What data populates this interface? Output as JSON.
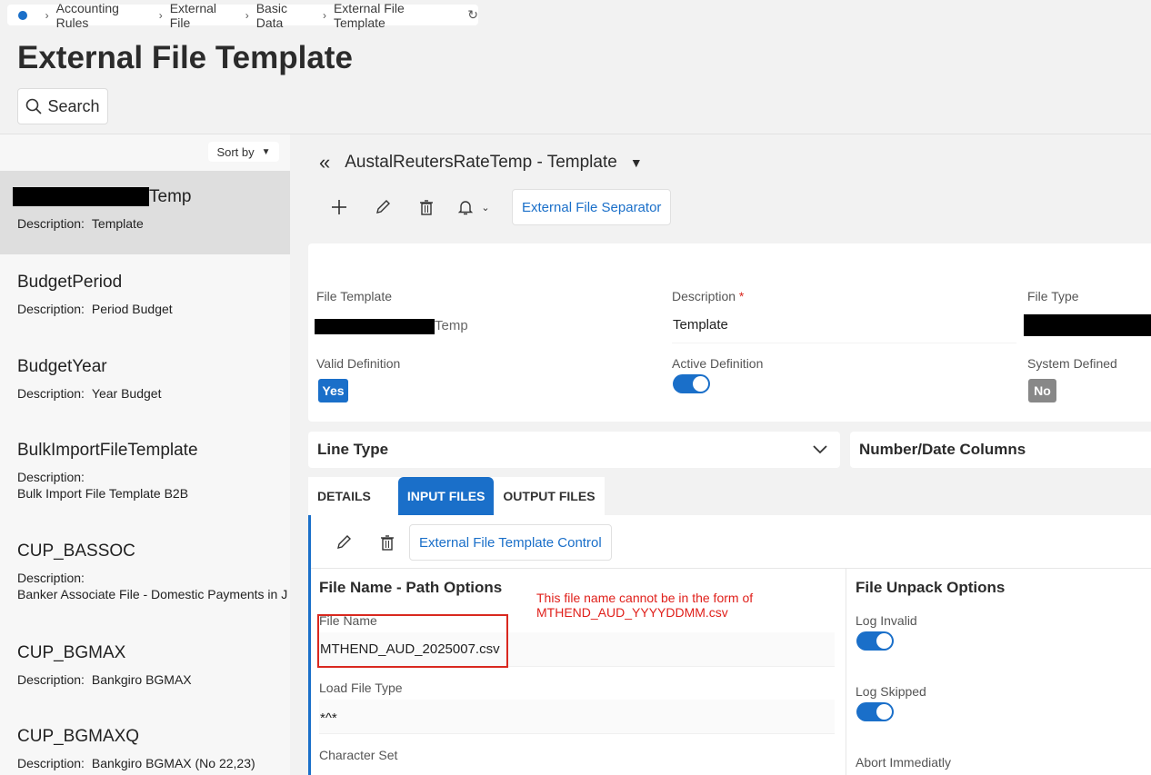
{
  "breadcrumb": {
    "items": [
      "Accounting Rules",
      "External File",
      "Basic Data",
      "External File Template"
    ]
  },
  "page_title": "External File Template",
  "search": {
    "label": "Search"
  },
  "sort": {
    "label": "Sort by"
  },
  "list": {
    "items": [
      {
        "title_suffix": "Temp",
        "desc_label": "Description:",
        "desc_value": "Template"
      },
      {
        "title": "BudgetPeriod",
        "desc_label": "Description:",
        "desc_value": "Period Budget"
      },
      {
        "title": "BudgetYear",
        "desc_label": "Description:",
        "desc_value": "Year Budget"
      },
      {
        "title": "BulkImportFileTemplate",
        "desc_label": "Description:",
        "desc_value": "Bulk Import File Template B2B"
      },
      {
        "title": "CUP_BASSOC",
        "desc_label": "Description:",
        "desc_value": "Banker Associate File - Domestic Payments in J"
      },
      {
        "title": "CUP_BGMAX",
        "desc_label": "Description:",
        "desc_value": "Bankgiro BGMAX"
      },
      {
        "title": "CUP_BGMAXQ",
        "desc_label": "Description:",
        "desc_value": "Bankgiro BGMAX (No 22,23)"
      }
    ]
  },
  "record": {
    "header": "AustalReutersRateTemp - Template",
    "toolbar": {
      "separator_button": "External File Separator"
    },
    "fields": {
      "file_template_label": "File Template",
      "file_template_suffix": "Temp",
      "description_label": "Description",
      "description_required": "*",
      "description_value": "Template",
      "file_type_label": "File Type",
      "valid_definition_label": "Valid Definition",
      "valid_definition_value": "Yes",
      "active_definition_label": "Active Definition",
      "system_defined_label": "System Defined",
      "system_defined_value": "No"
    },
    "sections": {
      "line_type": "Line Type",
      "number_date_columns": "Number/Date Columns"
    },
    "tabs": [
      "DETAILS",
      "INPUT FILES",
      "OUTPUT FILES"
    ],
    "input_files": {
      "control_button": "External File Template Control",
      "path_options_title": "File Name - Path Options",
      "unpack_options_title": "File Unpack Options",
      "note_line1": "This file name cannot be in the form of",
      "note_line2": "MTHEND_AUD_YYYYDDMM.csv",
      "file_name_label": "File Name",
      "file_name_value": "MTHEND_AUD_2025007.csv",
      "load_file_type_label": "Load File Type",
      "load_file_type_value": "*^*",
      "character_set_label": "Character Set",
      "log_invalid_label": "Log Invalid",
      "log_skipped_label": "Log Skipped",
      "abort_immediately_label": "Abort Immediatly"
    }
  },
  "colors": {
    "accent": "#1a6fc9",
    "required": "#d9281f",
    "annotation": "#e0201b"
  }
}
